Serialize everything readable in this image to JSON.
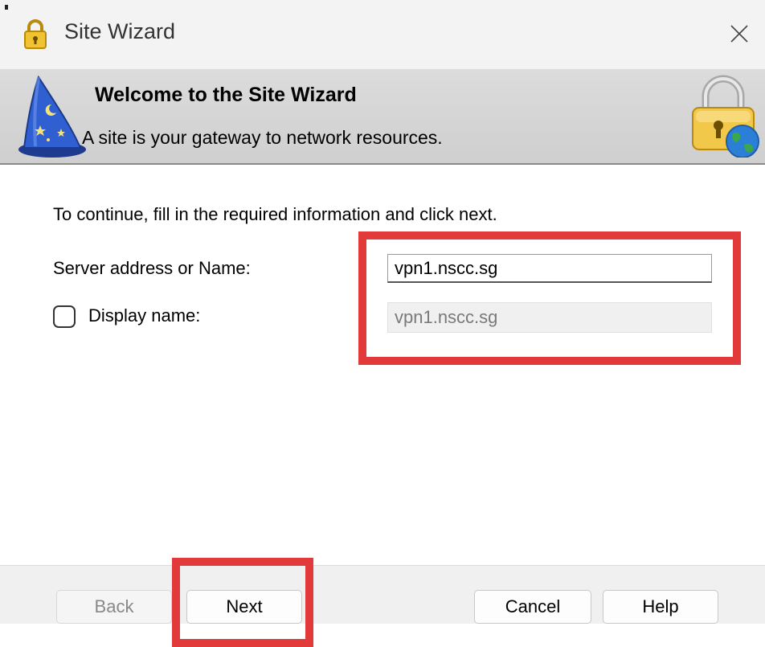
{
  "window": {
    "title": "Site Wizard",
    "icon": "lock-app-icon",
    "close_icon": "close-icon"
  },
  "header": {
    "title": "Welcome to the Site Wizard",
    "subtitle": "A site is your gateway to network resources.",
    "left_icon": "wizard-hat-icon",
    "right_icon": "lock-globe-icon"
  },
  "form": {
    "instructions": "To continue, fill in the required information and click next.",
    "server_label": "Server address or Name:",
    "server_value": "vpn1.nscc.sg",
    "display_checkbox_checked": false,
    "display_label": "Display name:",
    "display_value": "vpn1.nscc.sg"
  },
  "buttons": {
    "back": "Back",
    "next": "Next",
    "cancel": "Cancel",
    "help": "Help"
  },
  "colors": {
    "highlight": "#e23a3a",
    "header_band": "#d5d5d5"
  }
}
